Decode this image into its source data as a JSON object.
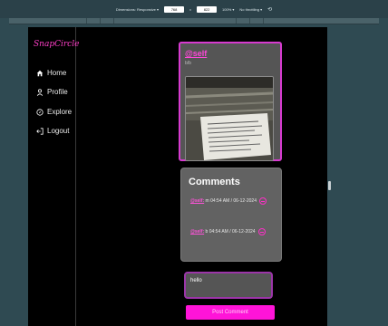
{
  "devtools": {
    "dimensions_label": "Dimensions: Responsive ▾",
    "width_value": "768",
    "times": "x",
    "height_value": "822",
    "zoom": "100% ▾",
    "throttle": "No throttling ▾"
  },
  "brand": {
    "logo_text": "SnapCircle"
  },
  "sidebar": {
    "items": [
      {
        "label": "Home",
        "icon": "home-icon"
      },
      {
        "label": "Profile",
        "icon": "user-icon"
      },
      {
        "label": "Explore",
        "icon": "compass-icon"
      },
      {
        "label": "Logout",
        "icon": "logout-icon"
      }
    ]
  },
  "post": {
    "handle": "@self",
    "subtitle": "b/b"
  },
  "comments": {
    "title": "Comments",
    "items": [
      {
        "user": "@self:",
        "text": " m 04:54 AM / 06-12-2024"
      },
      {
        "user": "@self:",
        "text": " b 04:54 AM / 06-12-2024"
      }
    ]
  },
  "composer": {
    "value": "hello",
    "button_label": "Post Comment"
  },
  "colors": {
    "accent": "#ff14d8",
    "panel": "#555555",
    "background": "#000000"
  }
}
